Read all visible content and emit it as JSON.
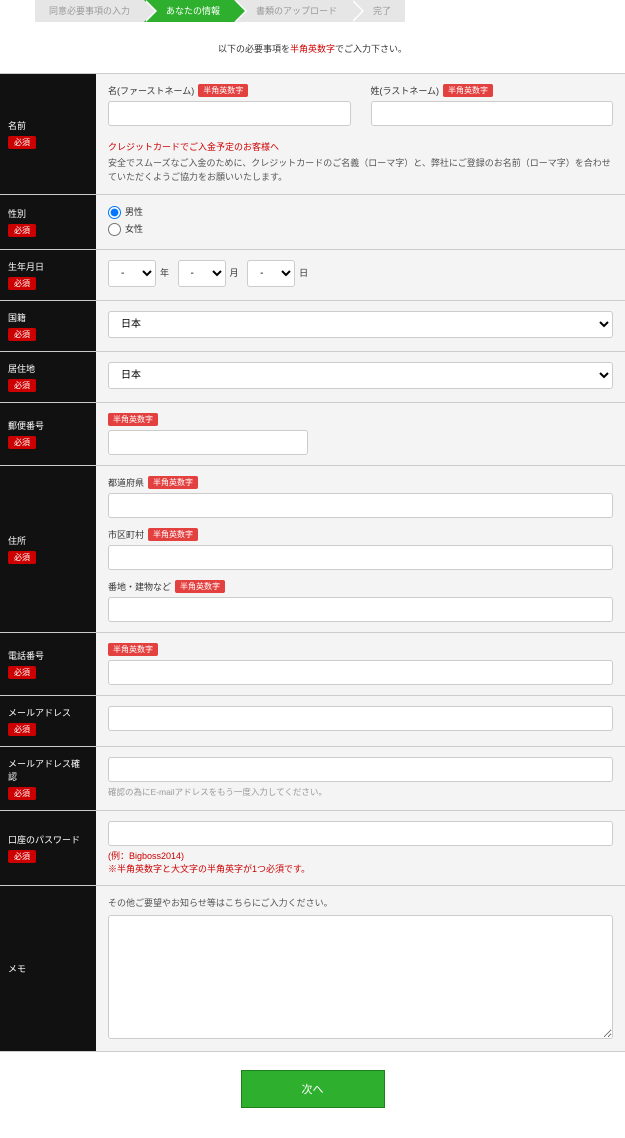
{
  "stepper": {
    "steps": [
      {
        "label": "同意必要事項の入力"
      },
      {
        "label": "あなたの情報"
      },
      {
        "label": "書類のアップロード"
      },
      {
        "label": "完了"
      }
    ]
  },
  "instructions": {
    "pre": "以下の必要事項を",
    "em": "半角英数字",
    "post": "でご入力下さい。"
  },
  "labels": {
    "name": "名前",
    "gender": "性別",
    "dob": "生年月日",
    "nationality": "国籍",
    "residence": "居住地",
    "postal": "郵便番号",
    "address": "住所",
    "phone": "電話番号",
    "email": "メールアドレス",
    "email_confirm": "メールアドレス確認",
    "password": "口座のパスワード",
    "memo": "メモ",
    "required": "必須"
  },
  "name": {
    "first_label": "名(ファーストネーム)",
    "last_label": "姓(ラストネーム)",
    "hanchi": "半角英数字",
    "notice_title": "クレジットカードでご入金予定のお客様へ",
    "notice_body": "安全でスムーズなご入金のために、クレジットカードのご名義（ローマ字）と、弊社にご登録のお名前（ローマ字）を合わせていただくようご協力をお願いいたします。"
  },
  "gender": {
    "male": "男性",
    "female": "女性"
  },
  "dob": {
    "year_opts": [
      "-"
    ],
    "month_opts": [
      "-"
    ],
    "day_opts": [
      "-"
    ],
    "year_unit": "年",
    "month_unit": "月",
    "day_unit": "日"
  },
  "nationality": {
    "selected": "日本"
  },
  "residence": {
    "selected": "日本"
  },
  "postal": {
    "hanchi": "半角英数字"
  },
  "address": {
    "prefecture": "都道府県",
    "city": "市区町村",
    "street": "番地・建物など",
    "hanchi": "半角英数字"
  },
  "phone": {
    "hanchi": "半角英数字"
  },
  "email_confirm_hint": "確認の為にE-mailアドレスをもう一度入力してください。",
  "password_hint1": "(例：Bigboss2014)",
  "password_hint2": "※半角英数字と大文字の半角英字が1つ必須です。",
  "memo_hint": "その他ご要望やお知らせ等はこちらにご入力ください。",
  "submit": "次へ"
}
